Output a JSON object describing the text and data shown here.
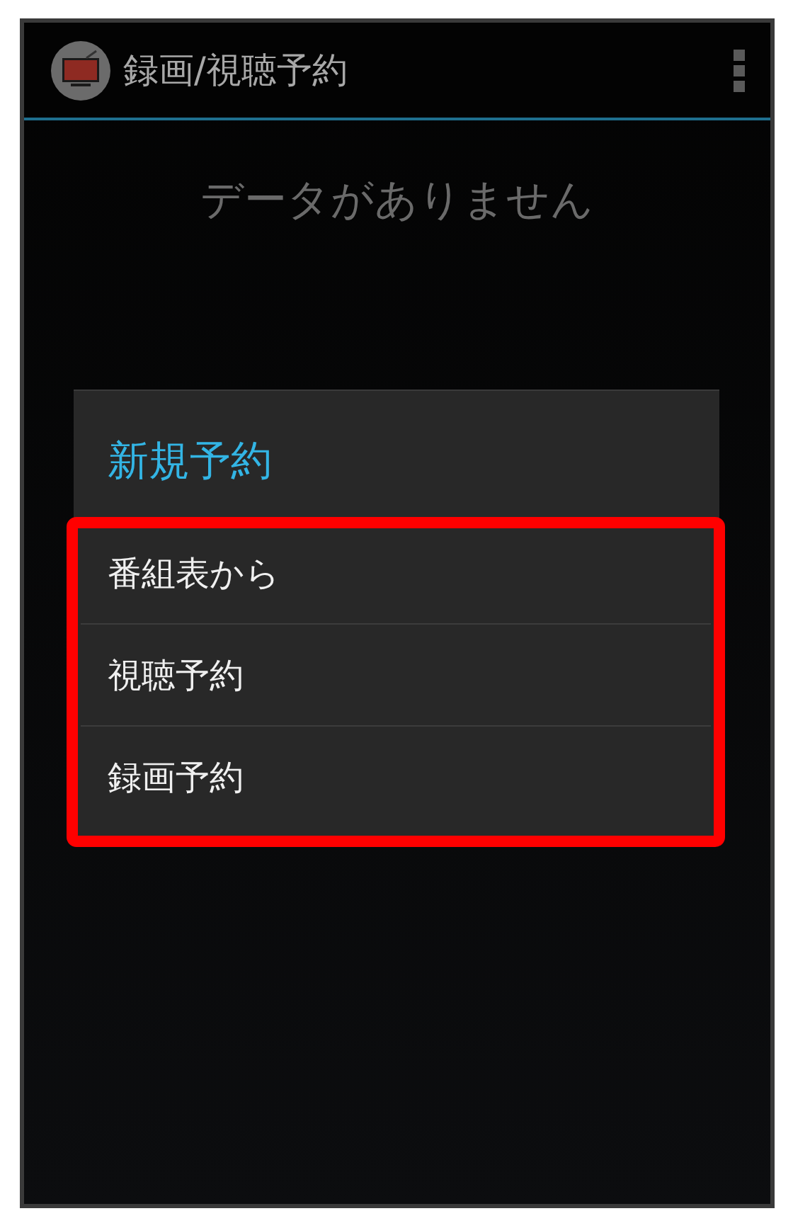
{
  "action_bar": {
    "title": "録画/視聴予約"
  },
  "empty_message": "データがありません",
  "dialog": {
    "title": "新規予約",
    "items": [
      {
        "label": "番組表から"
      },
      {
        "label": "視聴予約"
      },
      {
        "label": "録画予約"
      }
    ],
    "highlighted": true
  }
}
